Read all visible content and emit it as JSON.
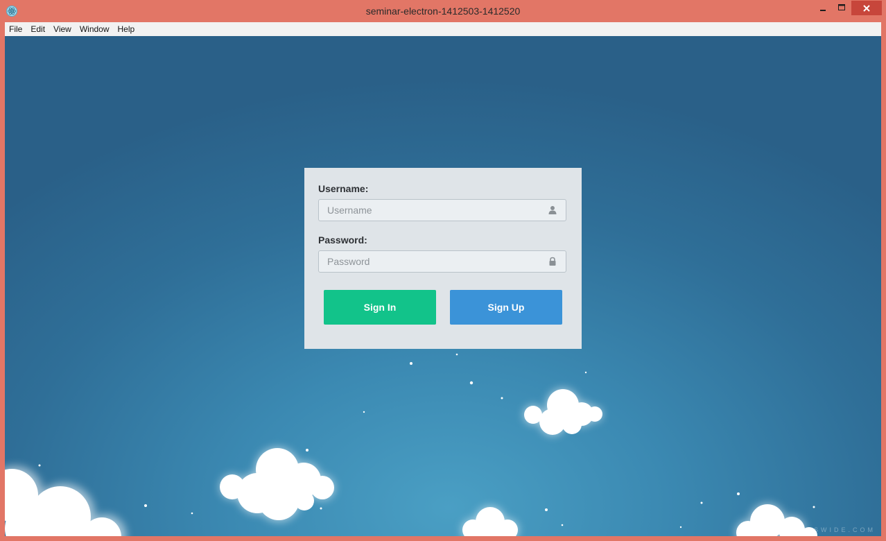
{
  "window": {
    "title": "seminar-electron-1412503-1412520",
    "icon": "electron-icon",
    "controls": {
      "minimize": "minimize-icon",
      "maximize": "maximize-icon",
      "close": "close-icon"
    }
  },
  "menu": {
    "items": [
      {
        "label": "File"
      },
      {
        "label": "Edit"
      },
      {
        "label": "View"
      },
      {
        "label": "Window"
      },
      {
        "label": "Help"
      }
    ]
  },
  "login": {
    "username_label": "Username:",
    "username_placeholder": "Username",
    "username_icon": "user-icon",
    "password_label": "Password:",
    "password_placeholder": "Password",
    "password_icon": "lock-icon",
    "signin_label": "Sign In",
    "signup_label": "Sign Up"
  },
  "watermark": "WALLPAPERSWIDE.COM",
  "colors": {
    "titlebar": "#e27666",
    "close_button": "#c7463b",
    "menubar": "#f2f2f2",
    "panel": "#dfe4e8",
    "signin": "#12c38a",
    "signup": "#3b93d8",
    "sky_center": "#4a9fc4",
    "sky_edge": "#2a6088"
  }
}
